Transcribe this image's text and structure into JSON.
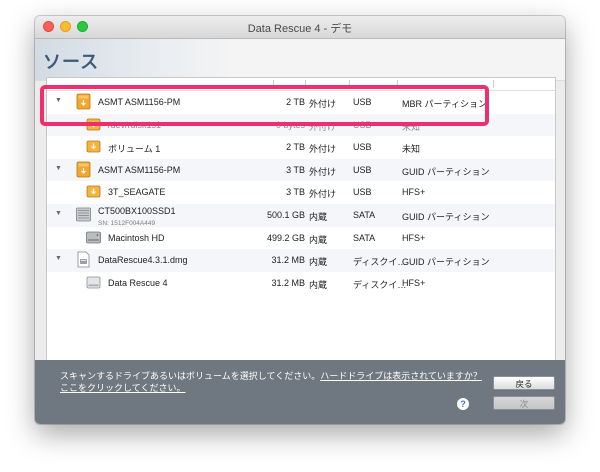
{
  "window": {
    "title": "Data Rescue 4 - デモ"
  },
  "header": {
    "title": "ソース"
  },
  "rows": [
    {
      "name": "ASMT ASM1156-PM",
      "sub": "",
      "size": "2 TB",
      "location": "外付け",
      "connection": "USB",
      "format": "MBR パーティション",
      "icon": "external-drive-icon",
      "expanded": true
    },
    {
      "name": "/dev/rdisk1s1",
      "sub": "",
      "size": "0 bytes",
      "location": "外付け",
      "connection": "USB",
      "format": "未知",
      "icon": "volume-icon",
      "expanded": false
    },
    {
      "name": "ボリューム 1",
      "sub": "",
      "size": "2 TB",
      "location": "外付け",
      "connection": "USB",
      "format": "未知",
      "icon": "volume-icon",
      "expanded": false
    },
    {
      "name": "ASMT ASM1156-PM",
      "sub": "",
      "size": "3 TB",
      "location": "外付け",
      "connection": "USB",
      "format": "GUID パーティション",
      "icon": "external-drive-icon",
      "expanded": true
    },
    {
      "name": "3T_SEAGATE",
      "sub": "",
      "size": "3 TB",
      "location": "外付け",
      "connection": "USB",
      "format": "HFS+",
      "icon": "volume-icon",
      "expanded": false
    },
    {
      "name": "CT500BX100SSD1",
      "sub": "SN: 1512F004A449",
      "size": "500.1 GB",
      "location": "内蔵",
      "connection": "SATA",
      "format": "GUID パーティション",
      "icon": "internal-drive-icon",
      "expanded": true
    },
    {
      "name": "Macintosh HD",
      "sub": "",
      "size": "499.2 GB",
      "location": "内蔵",
      "connection": "SATA",
      "format": "HFS+",
      "icon": "internal-volume-icon",
      "expanded": false
    },
    {
      "name": "DataRescue4.3.1.dmg",
      "sub": "",
      "size": "31.2 MB",
      "location": "内蔵",
      "connection": "ディスクイ…",
      "format": "GUID パーティション",
      "icon": "disk-image-icon",
      "expanded": true
    },
    {
      "name": "Data Rescue 4",
      "sub": "",
      "size": "31.2 MB",
      "location": "内蔵",
      "connection": "ディスクイ…",
      "format": "HFS+",
      "icon": "mounted-volume-icon",
      "expanded": false
    }
  ],
  "footer": {
    "help_text": "スキャンするドライブあるいはボリュームを選択してください。",
    "help_link": "ハードドライブは表示されていますか？ここをクリックしてください。",
    "help_icon": "?",
    "back_label": "戻る",
    "next_label": "次"
  }
}
